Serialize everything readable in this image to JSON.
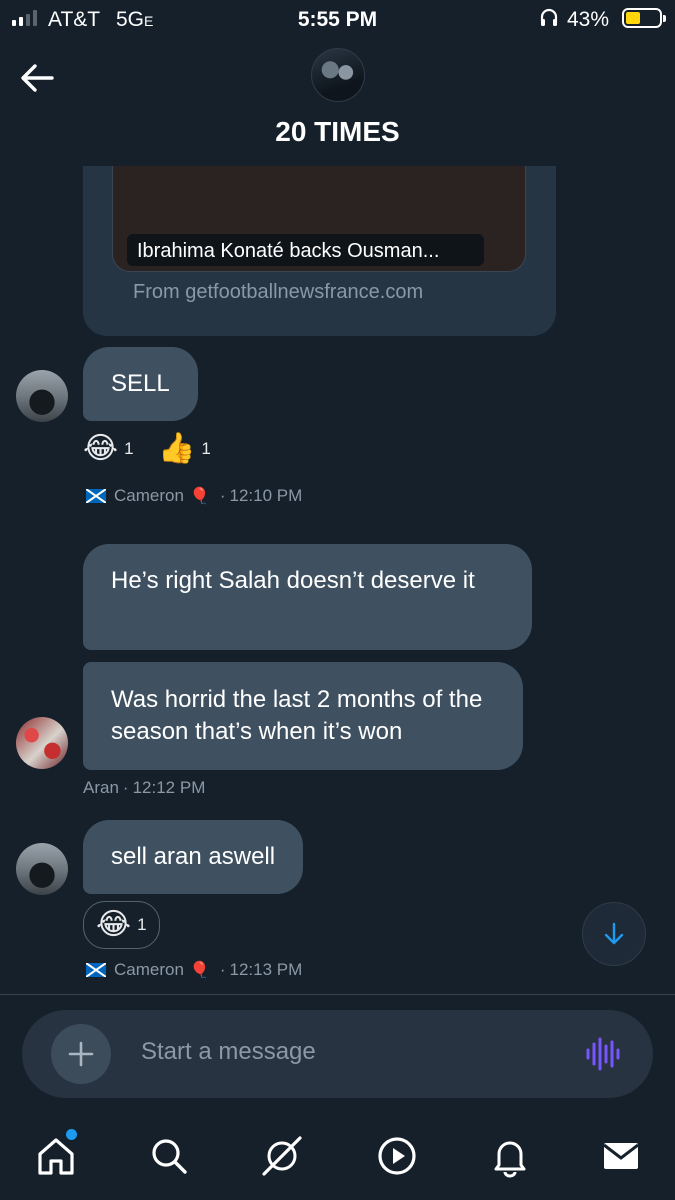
{
  "status_bar": {
    "carrier": "AT&T",
    "network": "5G",
    "network_suffix": "E",
    "time": "5:55 PM",
    "battery_percent": "43%",
    "battery_level": 0.43,
    "battery_color": "#ffd60a"
  },
  "header": {
    "title": "20 TIMES",
    "back_icon": "back-arrow-icon",
    "avatar_icon": "group-avatar"
  },
  "link_card": {
    "caption": "Ibrahima Konaté backs Ousman...",
    "source": "From getfootballnewsfrance.com"
  },
  "messages": [
    {
      "text": "SELL",
      "reactions": [
        {
          "emoji": "😂",
          "count": "1"
        },
        {
          "emoji": "👍",
          "count": "1"
        }
      ],
      "sender": "Cameron",
      "time": "12:10 PM"
    },
    {
      "text": "He’s right Salah doesn’t deserve it"
    },
    {
      "text": "Was horrid the last 2 months of the season that’s when it’s won",
      "sender": "Aran",
      "time": "12:12 PM"
    },
    {
      "text": "sell aran aswell",
      "reactions": [
        {
          "emoji": "😂",
          "count": "1"
        }
      ],
      "sender": "Cameron",
      "time": "12:13 PM"
    }
  ],
  "meta_separator": "·",
  "composer": {
    "placeholder": "Start a message"
  },
  "tab_bar": [
    "home-icon",
    "search-icon",
    "grok-icon",
    "video-icon",
    "notifications-icon",
    "messages-icon"
  ],
  "colors": {
    "background": "#15202b",
    "bubble": "#3f5161",
    "accent": "#1d9bf0",
    "voice": "#7856ff"
  }
}
